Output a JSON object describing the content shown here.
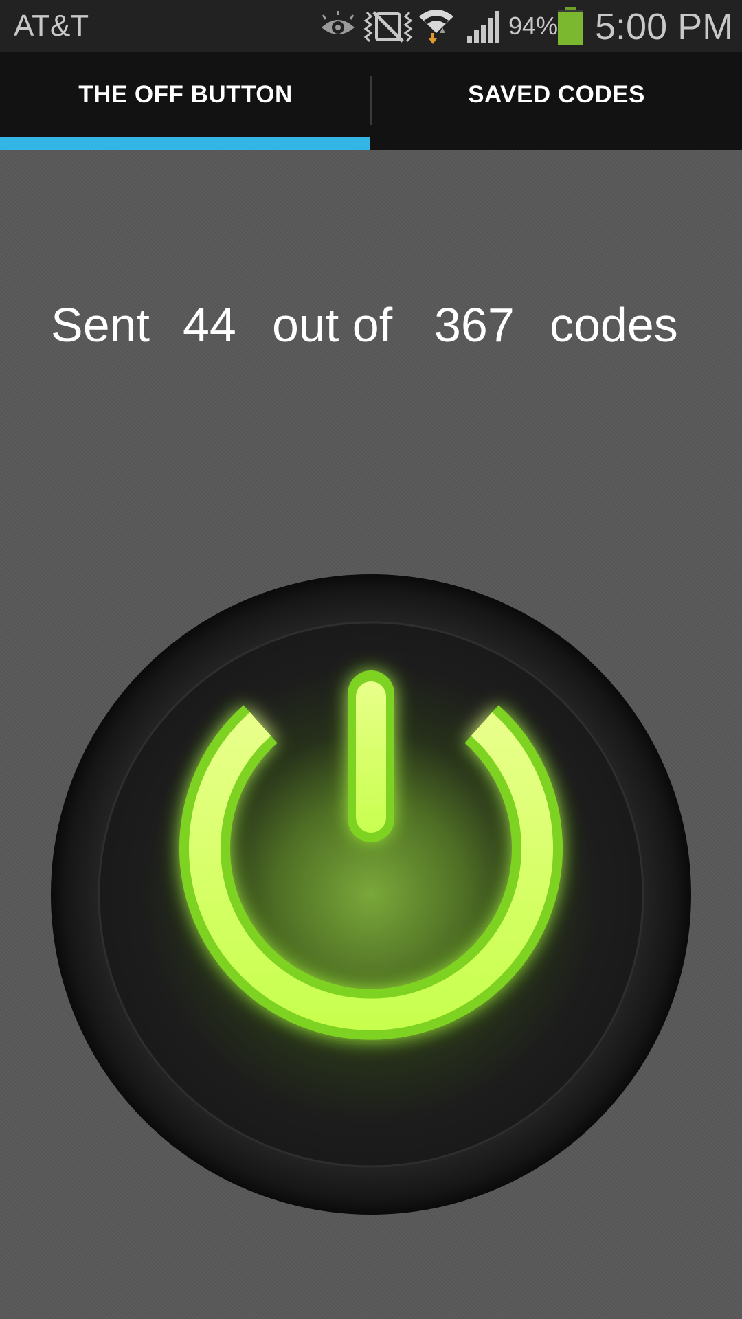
{
  "status_bar": {
    "carrier": "AT&T",
    "battery_percent": "94%",
    "time": "5:00 PM",
    "icons": [
      "eye-icon",
      "nfc-vibrate-muted-icon",
      "wifi-icon",
      "signal-icon",
      "battery-icon"
    ],
    "battery_level": 0.94,
    "battery_color": "#7cb82f"
  },
  "tabs": [
    {
      "label": "THE OFF BUTTON",
      "selected": true
    },
    {
      "label": "SAVED CODES",
      "selected": false
    }
  ],
  "accent_color": "#33b5e5",
  "main": {
    "sent_label": "Sent",
    "sent_count": "44",
    "out_of_label": "out of",
    "total_count": "367",
    "codes_label": "codes",
    "power_button": {
      "icon": "power-icon",
      "glow_color": "#b6ff3c"
    }
  }
}
